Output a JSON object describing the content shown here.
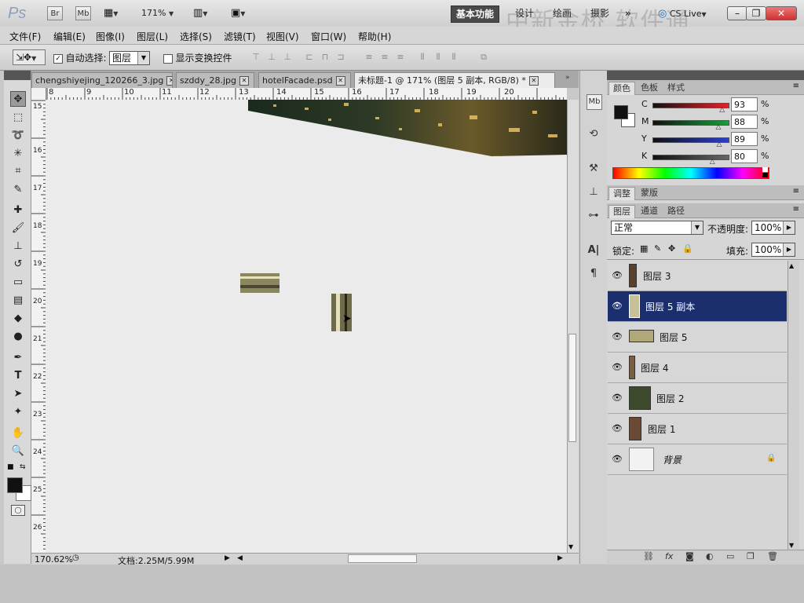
{
  "appbar": {
    "logo": "Ps",
    "bridge_label": "Br",
    "minibridge_label": "Mb",
    "zoom": "171%",
    "workspaces": [
      "基本功能",
      "设计",
      "绘画",
      "摄影"
    ],
    "more": "»",
    "cs_live": "CS Live",
    "watermark": "中新金桥 软件通"
  },
  "menu": [
    "文件(F)",
    "编辑(E)",
    "图像(I)",
    "图层(L)",
    "选择(S)",
    "滤镜(T)",
    "视图(V)",
    "窗口(W)",
    "帮助(H)"
  ],
  "options": {
    "auto_select_label": "自动选择:",
    "auto_select_value": "图层",
    "show_transform_label": "显示变换控件"
  },
  "tabs": [
    {
      "label": "chengshiyejing_120266_3.jpg"
    },
    {
      "label": "szddy_28.jpg"
    },
    {
      "label": "hotelFacade.psd"
    },
    {
      "label": "未标题-1 @ 171% (图层 5 副本, RGB/8) *"
    }
  ],
  "ruler": {
    "h": [
      "8",
      "9",
      "10",
      "11",
      "12",
      "13",
      "14",
      "15",
      "16",
      "17",
      "18",
      "19",
      "20"
    ],
    "v": [
      "15",
      "16",
      "17",
      "18",
      "19",
      "20",
      "21",
      "22",
      "23",
      "24",
      "25",
      "26"
    ]
  },
  "status": {
    "zoom": "170.62%",
    "doc": "文档:2.25M/5.99M"
  },
  "color_panel": {
    "tabs": [
      "颜色",
      "色板",
      "样式"
    ],
    "channels": [
      {
        "label": "C",
        "value": "93",
        "fraction": 0.93,
        "color": "#e8202a"
      },
      {
        "label": "M",
        "value": "88",
        "fraction": 0.88,
        "color": "#1a9e3a"
      },
      {
        "label": "Y",
        "value": "89",
        "fraction": 0.89,
        "color": "#2a3ed0"
      },
      {
        "label": "K",
        "value": "80",
        "fraction": 0.8,
        "color": "#666666"
      }
    ],
    "pct": "%"
  },
  "adjust_panel": {
    "tabs": [
      "调整",
      "蒙版"
    ]
  },
  "layers_panel": {
    "tabs": [
      "图层",
      "通道",
      "路径"
    ],
    "blend_mode": "正常",
    "opacity_label": "不透明度:",
    "opacity": "100%",
    "lock_label": "锁定:",
    "fill_label": "填充:",
    "fill": "100%",
    "layers": [
      {
        "name": "图层 3"
      },
      {
        "name": "图层 5 副本"
      },
      {
        "name": "图层 5"
      },
      {
        "name": "图层 4"
      },
      {
        "name": "图层 2"
      },
      {
        "name": "图层 1"
      },
      {
        "name": "背景"
      }
    ]
  }
}
